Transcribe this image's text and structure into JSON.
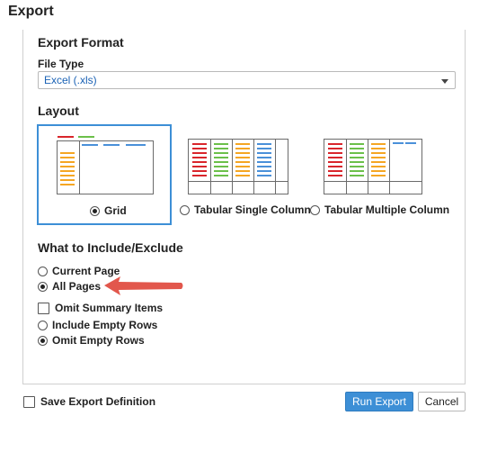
{
  "dialog": {
    "title": "Export"
  },
  "export_format": {
    "heading": "Export Format",
    "file_type_label": "File Type",
    "file_type_value": "Excel (.xls)"
  },
  "layout": {
    "heading": "Layout",
    "options": [
      {
        "label": "Grid",
        "selected": true
      },
      {
        "label": "Tabular Single Column",
        "selected": false
      },
      {
        "label": "Tabular Multiple Column",
        "selected": false
      }
    ]
  },
  "include": {
    "heading": "What to Include/Exclude",
    "page_options": [
      {
        "label": "Current Page",
        "selected": false
      },
      {
        "label": "All Pages",
        "selected": true
      }
    ],
    "omit_summary_label": "Omit Summary Items",
    "row_options": [
      {
        "label": "Include Empty Rows",
        "selected": false
      },
      {
        "label": "Omit Empty Rows",
        "selected": true
      }
    ]
  },
  "footer": {
    "save_definition_label": "Save Export Definition",
    "run_label": "Run Export",
    "cancel_label": "Cancel"
  },
  "colors": {
    "accent": "#3d8fd6",
    "red": "#d9262c",
    "green": "#6cc04a",
    "orange": "#f5a623",
    "blue": "#4a90d9",
    "arrow": "#e2574c"
  }
}
